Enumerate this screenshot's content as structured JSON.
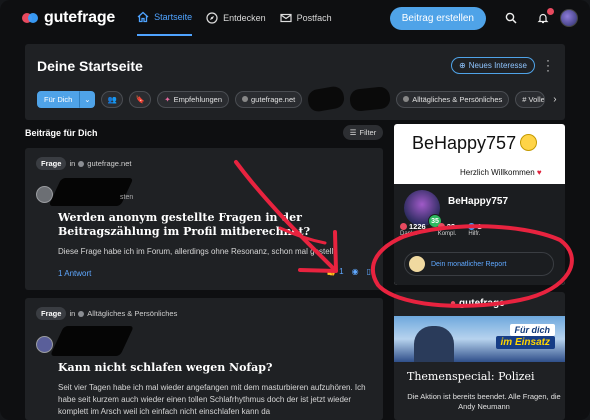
{
  "nav": {
    "logo": "gutefrage",
    "items": [
      {
        "label": "Startseite",
        "icon": "home-icon",
        "active": true
      },
      {
        "label": "Entdecken",
        "icon": "compass-icon",
        "active": false
      },
      {
        "label": "Postfach",
        "icon": "mail-icon",
        "active": false
      }
    ],
    "create_button": "Beitrag erstellen",
    "notification_badge": "1"
  },
  "start": {
    "title": "Deine Startseite",
    "new_interest_button": "Neues Interesse",
    "chips": {
      "for_you": "Für Dich",
      "recommendations": "Empfehlungen",
      "gutefrage": "gutefrage.net",
      "everyday": "Alltägliches & Persönliches",
      "volley": "# Volle"
    }
  },
  "feed": {
    "section_title": "Beiträge für Dich",
    "filter_button": "Filter",
    "posts": [
      {
        "tag": "Frage",
        "in_label": "in",
        "topic": "gutefrage.net",
        "author_suffix": "sten",
        "title": "Werden anonym gestellte Fragen in der Beitragszählung im Profil mitberechnet?",
        "body": "Diese Frage habe ich im Forum, allerdings ohne Resonanz, schon mal gestellt.",
        "answers": "1 Antwort",
        "likes": "1"
      },
      {
        "tag": "Frage",
        "in_label": "in",
        "topic": "Alltägliches & Persönliches",
        "title": "Kann nicht schlafen wegen Nofap?",
        "body": "Seit vier Tagen habe ich mal wieder angefangen mit dem masturbieren aufzuhören. Ich habe seit kurzem auch wieder einen tollen Schlafrhythmus doch der ist jetzt wieder komplett im Arsch weil ich einfach nicht einschlafen kann da"
      }
    ]
  },
  "profile": {
    "display_title": "BeHappy757",
    "welcome": "Herzlich Willkommen",
    "username": "BeHappy757",
    "level": "35",
    "stats": [
      {
        "value": "1226",
        "label": "Danke"
      },
      {
        "value": "23",
        "label": "Kompl."
      },
      {
        "value": "1",
        "label": "Hilfr."
      }
    ],
    "report_link": "Dein monatlicher Report"
  },
  "promo": {
    "logo": "gutefrage",
    "image_line1": "Für dich",
    "image_line2": "im Einsatz",
    "title": "Themenspecial: Polizei",
    "text": "Die Aktion ist bereits beendet. Alle Fragen, die Andy Neumann"
  },
  "colors": {
    "accent": "#4fa3e8",
    "link": "#5fa8ff",
    "annotation": "#e8233f",
    "card_bg": "#1f2124",
    "page_bg": "#0e0f11"
  }
}
